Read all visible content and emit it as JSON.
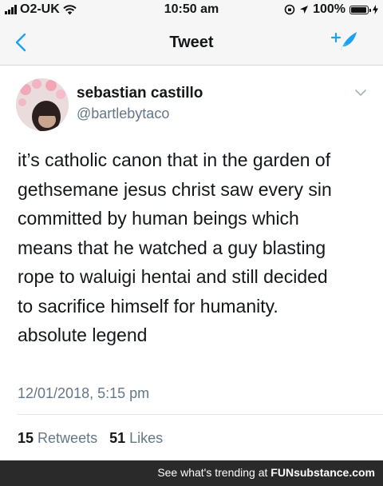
{
  "status_bar": {
    "carrier": "O2-UK",
    "time": "10:50 am",
    "battery": "100%",
    "battery_level": 1.0
  },
  "nav": {
    "title": "Tweet",
    "back_icon": "chevron-left-icon",
    "compose_icon": "compose-tweet-icon",
    "accent_color": "#1da1f2"
  },
  "tweet": {
    "display_name": "sebastian castillo",
    "handle": "@bartlebytaco",
    "text": "it’s catholic canon that in the garden of\ngethsemane jesus christ saw every sin\ncommitted by human beings which\nmeans that he watched a guy blasting\nrope to waluigi hentai and still decided\nto sacrifice himself for humanity.\nabsolute legend",
    "timestamp": "12/01/2018, 5:15 pm",
    "retweet_count": "15",
    "retweet_label": "Retweets",
    "like_count": "51",
    "like_label": "Likes"
  },
  "footer": {
    "text": "See what's trending at",
    "brand": "FUNsubstance.com"
  }
}
